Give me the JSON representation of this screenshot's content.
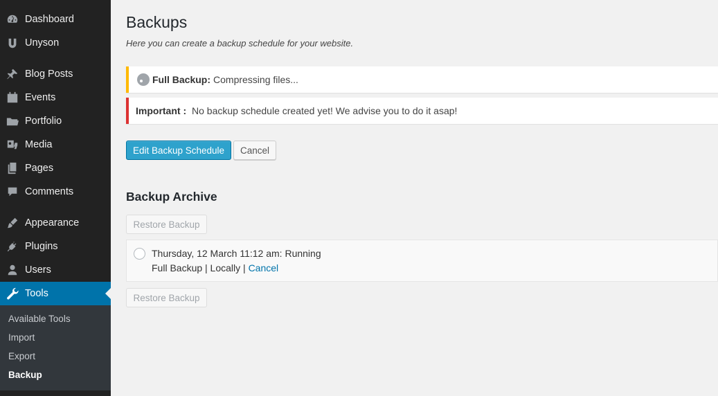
{
  "sidebar": {
    "items": [
      {
        "label": "Dashboard",
        "icon": "dashboard-icon"
      },
      {
        "label": "Unyson",
        "icon": "unyson-icon"
      },
      {
        "label": "Blog Posts",
        "icon": "pin-icon"
      },
      {
        "label": "Events",
        "icon": "calendar-icon"
      },
      {
        "label": "Portfolio",
        "icon": "folder-icon"
      },
      {
        "label": "Media",
        "icon": "media-icon"
      },
      {
        "label": "Pages",
        "icon": "pages-icon"
      },
      {
        "label": "Comments",
        "icon": "comment-icon"
      },
      {
        "label": "Appearance",
        "icon": "brush-icon"
      },
      {
        "label": "Plugins",
        "icon": "plug-icon"
      },
      {
        "label": "Users",
        "icon": "user-icon"
      },
      {
        "label": "Tools",
        "icon": "wrench-icon",
        "active": true
      }
    ],
    "submenu": [
      {
        "label": "Available Tools"
      },
      {
        "label": "Import"
      },
      {
        "label": "Export"
      },
      {
        "label": "Backup",
        "current": true
      }
    ]
  },
  "main": {
    "title": "Backups",
    "subtitle": "Here you can create a backup schedule for your website.",
    "notice_progress": {
      "bold": "Full Backup:",
      "text": "Compressing files..."
    },
    "notice_important": {
      "bold": "Important :",
      "text": "No backup schedule created yet! We advise you to do it asap!"
    },
    "edit_schedule_label": "Edit Backup Schedule",
    "cancel_label": "Cancel",
    "archive_title": "Backup Archive",
    "restore_label": "Restore Backup",
    "archive_entry": {
      "line1": "Thursday, 12 March 11:12 am: Running",
      "line2_prefix": "Full Backup | Locally |",
      "cancel_link": "Cancel"
    }
  },
  "colors": {
    "sidebar_bg": "#222222",
    "submenu_bg": "#32373c",
    "active_bg": "#0073aa",
    "primary_button": "#2ea2cc",
    "warning_border": "#ffb900",
    "error_border": "#dc3232",
    "link": "#0073aa"
  }
}
